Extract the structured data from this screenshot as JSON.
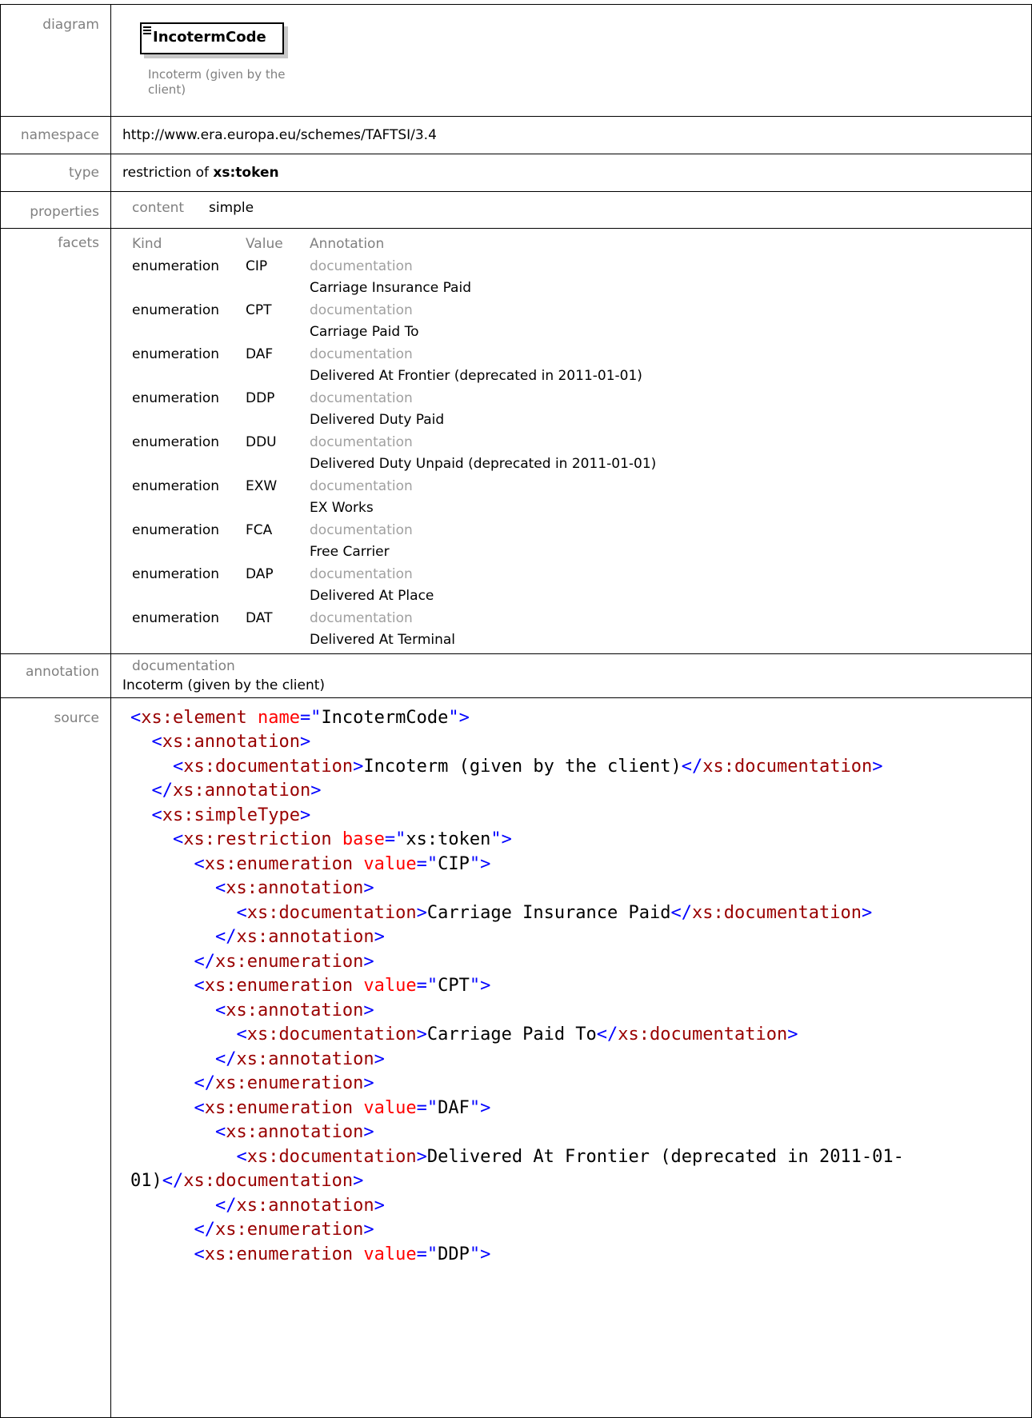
{
  "labels": {
    "diagram": "diagram",
    "namespace": "namespace",
    "type": "type",
    "properties": "properties",
    "facets": "facets",
    "annotation": "annotation",
    "source": "source"
  },
  "diagram": {
    "element_name": "IncotermCode",
    "documentation": "Incoterm (given by the client)"
  },
  "namespace": "http://www.era.europa.eu/schemes/TAFTSI/3.4",
  "type": {
    "prefix": "restriction of",
    "base": "xs:token"
  },
  "properties": {
    "key": "content",
    "value": "simple"
  },
  "facets": {
    "headers": [
      "Kind",
      "Value",
      "Annotation"
    ],
    "doc_label": "documentation",
    "rows": [
      {
        "kind": "enumeration",
        "value": "CIP",
        "doc": "Carriage Insurance Paid"
      },
      {
        "kind": "enumeration",
        "value": "CPT",
        "doc": "Carriage Paid To"
      },
      {
        "kind": "enumeration",
        "value": "DAF",
        "doc": "Delivered At Frontier (deprecated in 2011-01-01)"
      },
      {
        "kind": "enumeration",
        "value": "DDP",
        "doc": "Delivered Duty Paid"
      },
      {
        "kind": "enumeration",
        "value": "DDU",
        "doc": "Delivered Duty Unpaid (deprecated in 2011-01-01)"
      },
      {
        "kind": "enumeration",
        "value": "EXW",
        "doc": "EX Works"
      },
      {
        "kind": "enumeration",
        "value": "FCA",
        "doc": "Free Carrier"
      },
      {
        "kind": "enumeration",
        "value": "DAP",
        "doc": "Delivered At Place"
      },
      {
        "kind": "enumeration",
        "value": "DAT",
        "doc": "Delivered At Terminal"
      }
    ]
  },
  "annotation": {
    "label": "documentation",
    "text": "Incoterm (given by the client)"
  },
  "source_lines": [
    [
      [
        "t",
        "<"
      ],
      [
        "e",
        "xs:element"
      ],
      [
        "p",
        " "
      ],
      [
        "a",
        "name"
      ],
      [
        "t",
        "=\""
      ],
      [
        "p",
        "IncotermCode"
      ],
      [
        "t",
        "\">"
      ]
    ],
    [
      [
        "p",
        "  "
      ],
      [
        "t",
        "<"
      ],
      [
        "e",
        "xs:annotation"
      ],
      [
        "t",
        ">"
      ]
    ],
    [
      [
        "p",
        "    "
      ],
      [
        "t",
        "<"
      ],
      [
        "e",
        "xs:documentation"
      ],
      [
        "t",
        ">"
      ],
      [
        "p",
        "Incoterm (given by the client)"
      ],
      [
        "t",
        "</"
      ],
      [
        "e",
        "xs:documentation"
      ],
      [
        "t",
        ">"
      ]
    ],
    [
      [
        "p",
        "  "
      ],
      [
        "t",
        "</"
      ],
      [
        "e",
        "xs:annotation"
      ],
      [
        "t",
        ">"
      ]
    ],
    [
      [
        "p",
        "  "
      ],
      [
        "t",
        "<"
      ],
      [
        "e",
        "xs:simpleType"
      ],
      [
        "t",
        ">"
      ]
    ],
    [
      [
        "p",
        "    "
      ],
      [
        "t",
        "<"
      ],
      [
        "e",
        "xs:restriction"
      ],
      [
        "p",
        " "
      ],
      [
        "a",
        "base"
      ],
      [
        "t",
        "=\""
      ],
      [
        "p",
        "xs:token"
      ],
      [
        "t",
        "\">"
      ]
    ],
    [
      [
        "p",
        "      "
      ],
      [
        "t",
        "<"
      ],
      [
        "e",
        "xs:enumeration"
      ],
      [
        "p",
        " "
      ],
      [
        "a",
        "value"
      ],
      [
        "t",
        "=\""
      ],
      [
        "p",
        "CIP"
      ],
      [
        "t",
        "\">"
      ]
    ],
    [
      [
        "p",
        "        "
      ],
      [
        "t",
        "<"
      ],
      [
        "e",
        "xs:annotation"
      ],
      [
        "t",
        ">"
      ]
    ],
    [
      [
        "p",
        "          "
      ],
      [
        "t",
        "<"
      ],
      [
        "e",
        "xs:documentation"
      ],
      [
        "t",
        ">"
      ],
      [
        "p",
        "Carriage Insurance Paid"
      ],
      [
        "t",
        "</"
      ],
      [
        "e",
        "xs:documentation"
      ],
      [
        "t",
        ">"
      ]
    ],
    [
      [
        "p",
        "        "
      ],
      [
        "t",
        "</"
      ],
      [
        "e",
        "xs:annotation"
      ],
      [
        "t",
        ">"
      ]
    ],
    [
      [
        "p",
        "      "
      ],
      [
        "t",
        "</"
      ],
      [
        "e",
        "xs:enumeration"
      ],
      [
        "t",
        ">"
      ]
    ],
    [
      [
        "p",
        "      "
      ],
      [
        "t",
        "<"
      ],
      [
        "e",
        "xs:enumeration"
      ],
      [
        "p",
        " "
      ],
      [
        "a",
        "value"
      ],
      [
        "t",
        "=\""
      ],
      [
        "p",
        "CPT"
      ],
      [
        "t",
        "\">"
      ]
    ],
    [
      [
        "p",
        "        "
      ],
      [
        "t",
        "<"
      ],
      [
        "e",
        "xs:annotation"
      ],
      [
        "t",
        ">"
      ]
    ],
    [
      [
        "p",
        "          "
      ],
      [
        "t",
        "<"
      ],
      [
        "e",
        "xs:documentation"
      ],
      [
        "t",
        ">"
      ],
      [
        "p",
        "Carriage Paid To"
      ],
      [
        "t",
        "</"
      ],
      [
        "e",
        "xs:documentation"
      ],
      [
        "t",
        ">"
      ]
    ],
    [
      [
        "p",
        "        "
      ],
      [
        "t",
        "</"
      ],
      [
        "e",
        "xs:annotation"
      ],
      [
        "t",
        ">"
      ]
    ],
    [
      [
        "p",
        "      "
      ],
      [
        "t",
        "</"
      ],
      [
        "e",
        "xs:enumeration"
      ],
      [
        "t",
        ">"
      ]
    ],
    [
      [
        "p",
        "      "
      ],
      [
        "t",
        "<"
      ],
      [
        "e",
        "xs:enumeration"
      ],
      [
        "p",
        " "
      ],
      [
        "a",
        "value"
      ],
      [
        "t",
        "=\""
      ],
      [
        "p",
        "DAF"
      ],
      [
        "t",
        "\">"
      ]
    ],
    [
      [
        "p",
        "        "
      ],
      [
        "t",
        "<"
      ],
      [
        "e",
        "xs:annotation"
      ],
      [
        "t",
        ">"
      ]
    ],
    [
      [
        "p",
        "          "
      ],
      [
        "t",
        "<"
      ],
      [
        "e",
        "xs:documentation"
      ],
      [
        "t",
        ">"
      ],
      [
        "p",
        "Delivered At Frontier (deprecated in 2011-01-"
      ]
    ],
    [
      [
        "p",
        "01)"
      ],
      [
        "t",
        "</"
      ],
      [
        "e",
        "xs:documentation"
      ],
      [
        "t",
        ">"
      ]
    ],
    [
      [
        "p",
        "        "
      ],
      [
        "t",
        "</"
      ],
      [
        "e",
        "xs:annotation"
      ],
      [
        "t",
        ">"
      ]
    ],
    [
      [
        "p",
        "      "
      ],
      [
        "t",
        "</"
      ],
      [
        "e",
        "xs:enumeration"
      ],
      [
        "t",
        ">"
      ]
    ],
    [
      [
        "p",
        "      "
      ],
      [
        "t",
        "<"
      ],
      [
        "e",
        "xs:enumeration"
      ],
      [
        "p",
        " "
      ],
      [
        "a",
        "value"
      ],
      [
        "t",
        "=\""
      ],
      [
        "p",
        "DDP"
      ],
      [
        "t",
        "\">"
      ]
    ]
  ]
}
